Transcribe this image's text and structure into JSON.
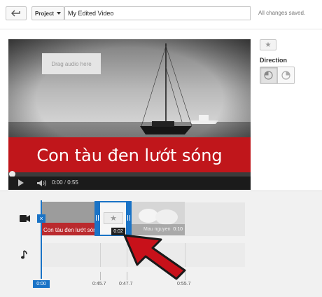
{
  "topbar": {
    "project_label": "Project",
    "title_value": "My Edited Video",
    "save_status": "All changes saved."
  },
  "player": {
    "caption": "Con tàu đen lướt sóng",
    "current_time": "0:00",
    "separator": "/",
    "duration": "0:55",
    "progress_fraction": 0.0
  },
  "panel": {
    "direction_label": "Direction"
  },
  "timeline": {
    "clip1_title": "Con tàu đen lướt sóng",
    "selected_clip_duration": "0:02",
    "clip3_label": "Mau nguyen",
    "clip3_duration": "0:10",
    "audio_placeholder": "Drag audio here",
    "playhead_time": "0:00",
    "ruler": [
      "0:45.7",
      "0:47.7",
      "0:55.7"
    ]
  },
  "colors": {
    "accent": "#1a73c6",
    "caption_band": "#c0161b",
    "arrow": "#c8111a"
  }
}
